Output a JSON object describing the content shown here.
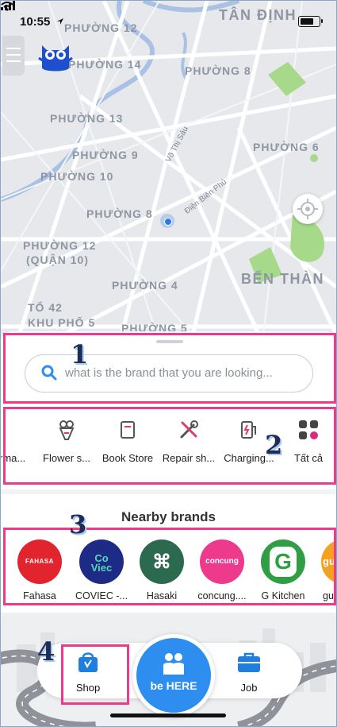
{
  "status_bar": {
    "time": "10:55"
  },
  "map": {
    "district_labels": [
      "TÂN ĐỊNH",
      "PHƯỜNG 12",
      "PHƯỜNG 14",
      "PHƯỜNG 8",
      "PHƯỜNG 13",
      "PHƯỜNG 9",
      "PHƯỜNG 6",
      "PHƯỜNG 10",
      "PHƯỜNG 8",
      "PHƯỜNG 12",
      "(QUẬN 10)",
      "PHƯỜNG 4",
      "BẾN THÀN",
      "TỔ 42",
      "KHU PHỐ 5",
      "PHƯỜNG 5"
    ],
    "street_labels": [
      "Võ Thị Sáu",
      "Điện Biên Phủ"
    ]
  },
  "search": {
    "placeholder": "what is the brand that you are looking..."
  },
  "annotations": [
    "1",
    "2",
    "3",
    "4"
  ],
  "categories": [
    {
      "label": "rma...",
      "icon": "cart-icon"
    },
    {
      "label": "Flower s...",
      "icon": "flower-bouquet-icon"
    },
    {
      "label": "Book Store",
      "icon": "book-icon"
    },
    {
      "label": "Repair sh...",
      "icon": "wrench-screwdriver-icon"
    },
    {
      "label": "Charging...",
      "icon": "charging-station-icon"
    },
    {
      "label": "Tất cả",
      "icon": "grid-icon"
    }
  ],
  "nearby": {
    "title": "Nearby brands",
    "brands": [
      {
        "name": "Fahasa",
        "logo_text": "FAHASA",
        "color": "#e2242e"
      },
      {
        "name": "COVIEC -...",
        "logo_text": "Co Viec",
        "color": "#1d2a86"
      },
      {
        "name": "Hasaki",
        "logo_text": "⌘",
        "color": "#2c6a4f"
      },
      {
        "name": "concung....",
        "logo_text": "concung",
        "color": "#ee3a8c"
      },
      {
        "name": "G Kitchen",
        "logo_text": "G",
        "color": "#2f9e44"
      },
      {
        "name": "gu",
        "logo_text": "gu",
        "color": "#f4a020"
      }
    ]
  },
  "bottom_nav": {
    "shop": "Shop",
    "behere": "be HERE",
    "job": "Job"
  },
  "colors": {
    "accent": "#2d8ef0",
    "highlight": "#ee3a8c"
  }
}
